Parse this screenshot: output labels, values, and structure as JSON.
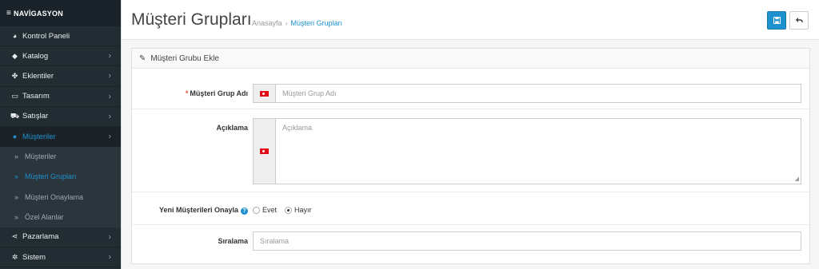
{
  "sidebar": {
    "header": "NAVİGASYON",
    "items": [
      {
        "label": "Kontrol Paneli",
        "icon": "dashboard-icon"
      },
      {
        "label": "Katalog",
        "icon": "tags-icon"
      },
      {
        "label": "Eklentiler",
        "icon": "puzzle-icon"
      },
      {
        "label": "Tasarım",
        "icon": "monitor-icon"
      },
      {
        "label": "Satışlar",
        "icon": "cart-icon"
      },
      {
        "label": "Müşteriler",
        "icon": "user-icon"
      },
      {
        "label": "Pazarlama",
        "icon": "share-icon"
      },
      {
        "label": "Sistem",
        "icon": "gear-icon"
      }
    ],
    "submenu": [
      {
        "label": "Müşteriler"
      },
      {
        "label": "Müşteri Grupları"
      },
      {
        "label": "Müşteri Onaylama"
      },
      {
        "label": "Özel Alanlar"
      }
    ]
  },
  "header": {
    "title": "Müşteri Grupları",
    "breadcrumb": [
      "Anasayfa",
      "Müşteri Grupları"
    ]
  },
  "panel": {
    "title": "Müşteri Grubu Ekle"
  },
  "form": {
    "name": {
      "label": "Müşteri Grup Adı",
      "placeholder": "Müşteri Grup Adı",
      "value": ""
    },
    "description": {
      "label": "Açıklama",
      "placeholder": "Açıklama",
      "value": ""
    },
    "approve": {
      "label": "Yeni Müşterileri Onayla",
      "help": "?",
      "options": [
        "Evet",
        "Hayır"
      ],
      "selected": "Hayır"
    },
    "sort": {
      "label": "Sıralama",
      "placeholder": "Sıralama",
      "value": ""
    }
  },
  "colors": {
    "accent": "#1e91cf",
    "sidebar_bg": "#222c33",
    "required": "#e3503e"
  }
}
